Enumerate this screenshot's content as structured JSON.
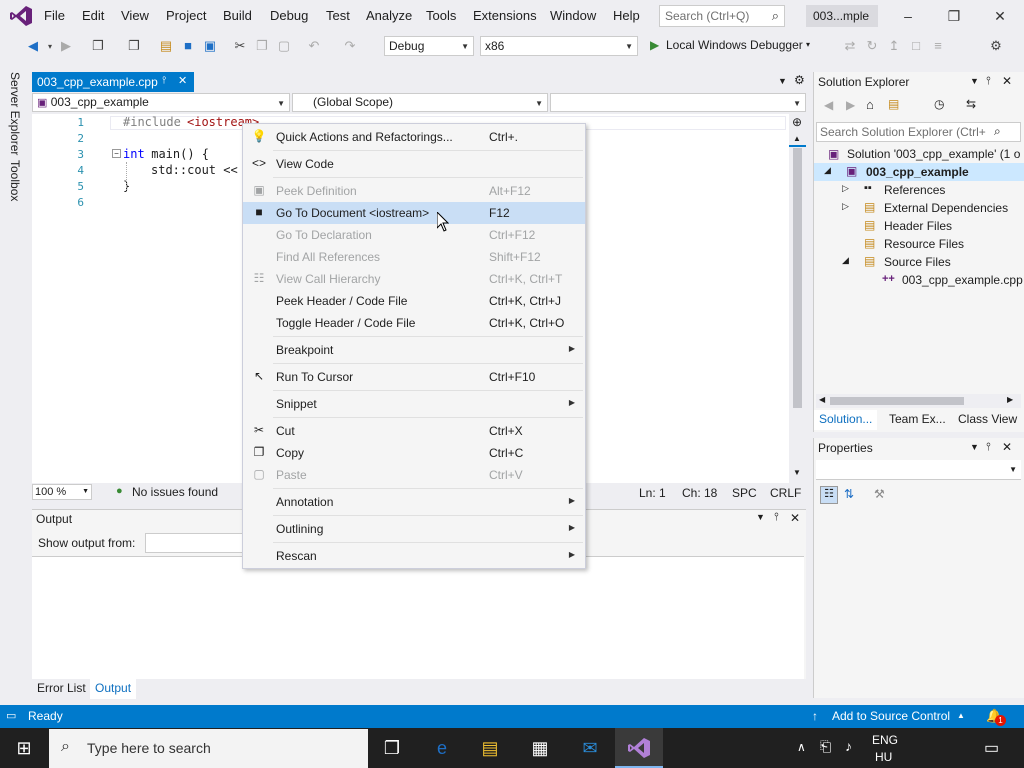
{
  "menubar": {
    "items": [
      "File",
      "Edit",
      "View",
      "Project",
      "Build",
      "Debug",
      "Test",
      "Analyze",
      "Tools",
      "Extensions",
      "Window",
      "Help"
    ],
    "search_placeholder": "Search (Ctrl+Q)",
    "solution_title": "003...mple"
  },
  "toolbar": {
    "config": "Debug",
    "platform": "x86",
    "run_label": "Local Windows Debugger"
  },
  "left_rail": {
    "server_explorer": "Server Explorer",
    "toolbox": "Toolbox"
  },
  "editor": {
    "tab_label": "003_cpp_example.cpp",
    "project_combo": "003_cpp_example",
    "scope_combo": "(Global Scope)",
    "line_numbers": [
      "1",
      "2",
      "3",
      "4",
      "5",
      "6"
    ],
    "lines": {
      "l1_directive": "#include",
      "l1_header": "<iostream>",
      "l3_kw": "int",
      "l3_rest": " main() {",
      "l4": "std::cout <<",
      "l5": "}"
    },
    "zoom": "100 %",
    "issues": "No issues found",
    "ln": "Ln: 1",
    "ch": "Ch: 18",
    "spc": "SPC",
    "crlf": "CRLF"
  },
  "output": {
    "title": "Output",
    "show_from": "Show output from:"
  },
  "bottom_tabs": [
    "Error List",
    "Output"
  ],
  "solution_explorer": {
    "title": "Solution Explorer",
    "search_placeholder": "Search Solution Explorer (Ctrl+",
    "solution": "Solution '003_cpp_example' (1 o",
    "project": "003_cpp_example",
    "items": [
      "References",
      "External Dependencies",
      "Header Files",
      "Resource Files",
      "Source Files"
    ],
    "file": "003_cpp_example.cpp",
    "tabs": [
      "Solution...",
      "Team Ex...",
      "Class View"
    ]
  },
  "properties": {
    "title": "Properties"
  },
  "statusbar": {
    "ready": "Ready",
    "source_control": "Add to Source Control",
    "notif": "1"
  },
  "taskbar": {
    "search_placeholder": "Type here to search",
    "lang": "ENG",
    "region": "HU"
  },
  "context_menu": {
    "items": [
      {
        "label": "Quick Actions and Refactorings...",
        "shortcut": "Ctrl+.",
        "icon": "lightbulb-icon"
      },
      {
        "label": "View Code",
        "shortcut": "",
        "icon": "code-icon"
      },
      {
        "label": "Peek Definition",
        "shortcut": "Alt+F12",
        "icon": "peek-icon",
        "disabled": true
      },
      {
        "label": "Go To Document <iostream>",
        "shortcut": "F12",
        "icon": "goto-icon",
        "highlight": true
      },
      {
        "label": "Go To Declaration",
        "shortcut": "Ctrl+F12",
        "disabled": true
      },
      {
        "label": "Find All References",
        "shortcut": "Shift+F12",
        "disabled": true
      },
      {
        "label": "View Call Hierarchy",
        "shortcut": "Ctrl+K, Ctrl+T",
        "icon": "hierarchy-icon",
        "disabled": true
      },
      {
        "label": "Peek Header / Code File",
        "shortcut": "Ctrl+K, Ctrl+J"
      },
      {
        "label": "Toggle Header / Code File",
        "shortcut": "Ctrl+K, Ctrl+O"
      },
      {
        "label": "Breakpoint",
        "shortcut": "",
        "submenu": true
      },
      {
        "label": "Run To Cursor",
        "shortcut": "Ctrl+F10",
        "icon": "cursor-icon"
      },
      {
        "label": "Snippet",
        "shortcut": "",
        "submenu": true
      },
      {
        "label": "Cut",
        "shortcut": "Ctrl+X",
        "icon": "scissors-icon"
      },
      {
        "label": "Copy",
        "shortcut": "Ctrl+C",
        "icon": "copy-icon"
      },
      {
        "label": "Paste",
        "shortcut": "Ctrl+V",
        "icon": "paste-icon",
        "disabled": true
      },
      {
        "label": "Annotation",
        "shortcut": "",
        "submenu": true
      },
      {
        "label": "Outlining",
        "shortcut": "",
        "submenu": true
      },
      {
        "label": "Rescan",
        "shortcut": "",
        "submenu": true
      }
    ]
  },
  "colors": {
    "accent": "#007acc",
    "vs_purple": "#68217a",
    "highlight": "#c9def5"
  }
}
